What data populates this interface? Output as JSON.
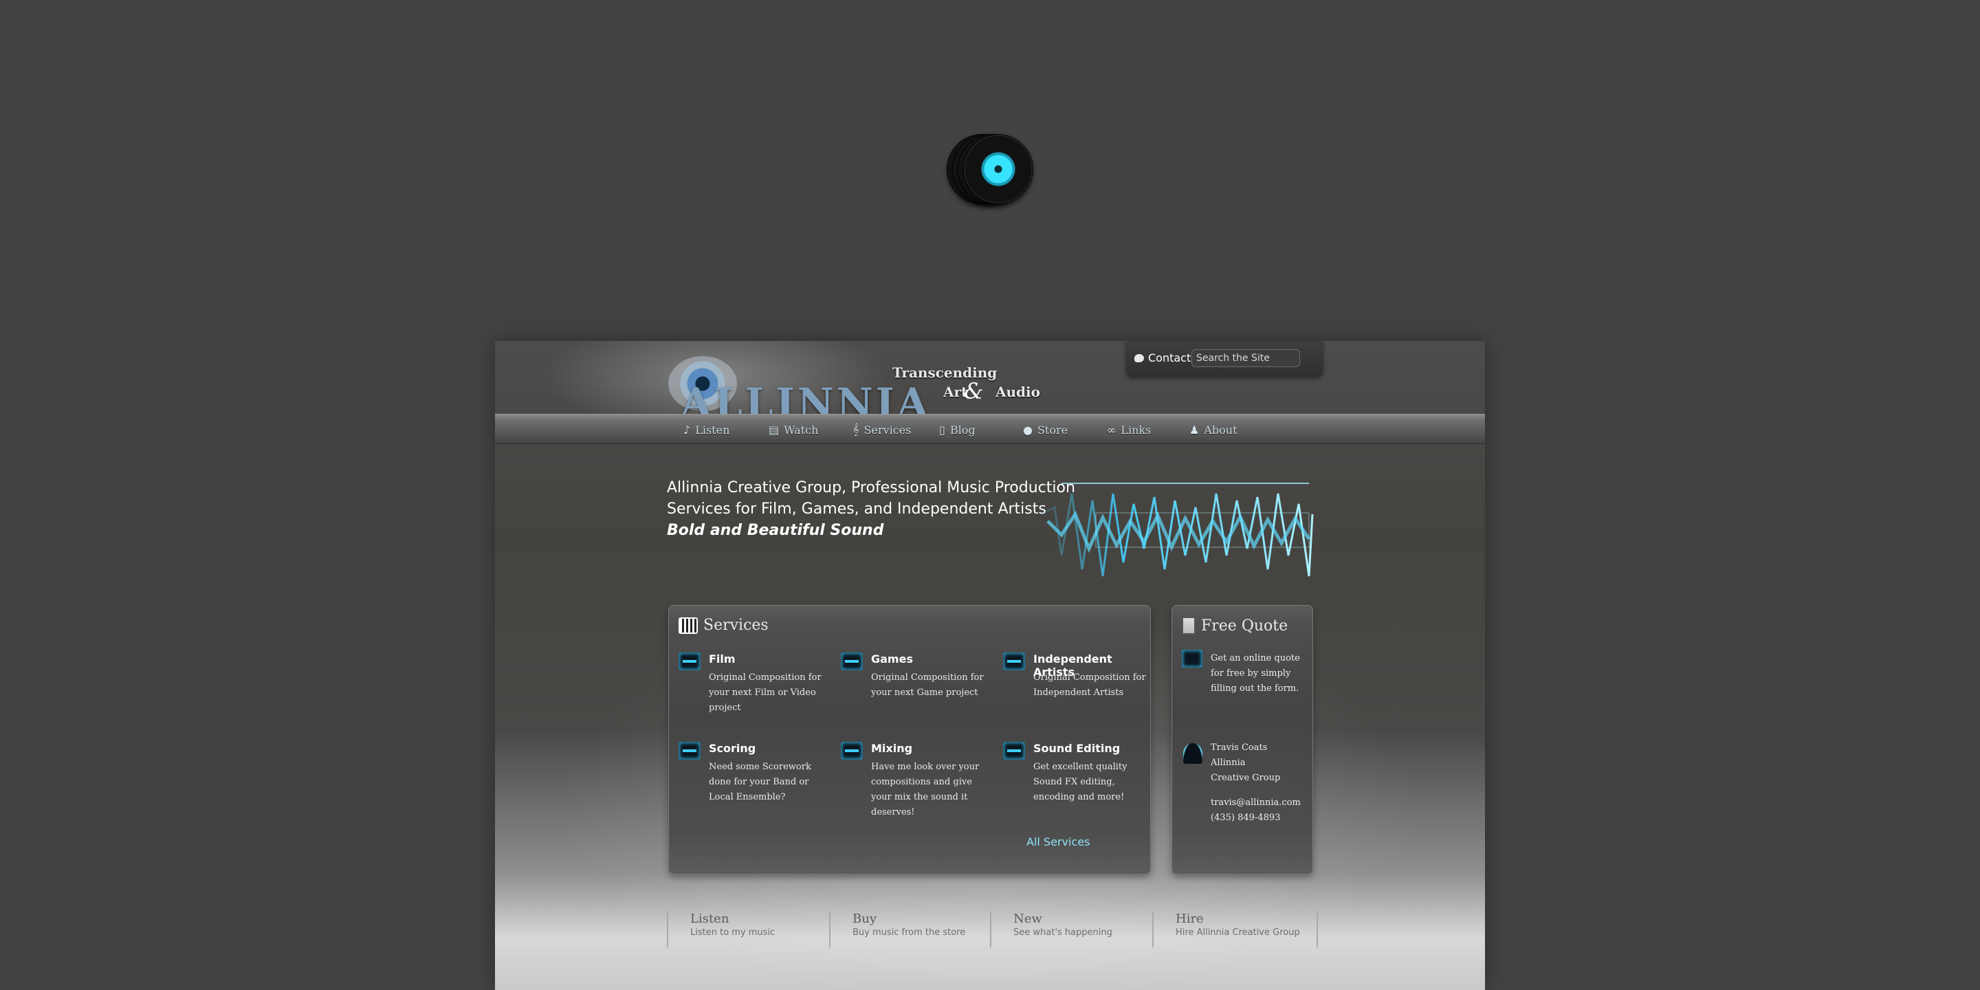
{
  "header": {
    "logo_text": "ALLINNIA",
    "tagline_line1": "Transcending",
    "tagline_art": "Art",
    "tagline_amp": "&",
    "tagline_audio": "Audio",
    "contact_label": "Contact",
    "search_placeholder": "Search the Site"
  },
  "nav": [
    {
      "label": "Listen",
      "icon": "music-note-icon"
    },
    {
      "label": "Watch",
      "icon": "film-icon"
    },
    {
      "label": "Services",
      "icon": "treble-clef-icon"
    },
    {
      "label": "Blog",
      "icon": "document-icon"
    },
    {
      "label": "Store",
      "icon": "disc-icon"
    },
    {
      "label": "Links",
      "icon": "chain-link-icon"
    },
    {
      "label": "About",
      "icon": "person-icon"
    }
  ],
  "hero": {
    "line1": "Allinnia Creative Group, Professional Music Production",
    "line2": "Services for Film, Games, and Independent Artists",
    "line3": "Bold and Beautiful Sound"
  },
  "services_panel": {
    "title": "Services",
    "items": [
      {
        "title": "Film",
        "desc": "Original Composition for your next Film or Video project"
      },
      {
        "title": "Games",
        "desc": "Original Composition for your next Game project"
      },
      {
        "title": "Independent Artists",
        "desc": "Original Composition for Independent Artists"
      },
      {
        "title": "Scoring",
        "desc": "Need some Scorework done for your Band or Local Ensemble?"
      },
      {
        "title": "Mixing",
        "desc": "Have me look over your compositions and give your mix the sound it deserves!"
      },
      {
        "title": "Sound Editing",
        "desc": "Get excellent quality Sound FX editing, encoding and more!"
      }
    ],
    "all_link": "All Services"
  },
  "quote_panel": {
    "title": "Free Quote",
    "text": "Get an online quote for free by simply filling out the form.",
    "name": "Travis Coats",
    "org": "Allinnia Creative Group",
    "email": "travis@allinnia.com",
    "phone": "(435) 849-4893"
  },
  "footer": [
    {
      "title": "Listen",
      "sub": "Listen to my music"
    },
    {
      "title": "Buy",
      "sub": "Buy music from the store"
    },
    {
      "title": "New",
      "sub": "See what's happening"
    },
    {
      "title": "Hire",
      "sub": "Hire Allinnia Creative Group"
    }
  ],
  "colors": {
    "background": "#434343",
    "accent": "#3fd0ff",
    "link": "#8fe0f5"
  }
}
